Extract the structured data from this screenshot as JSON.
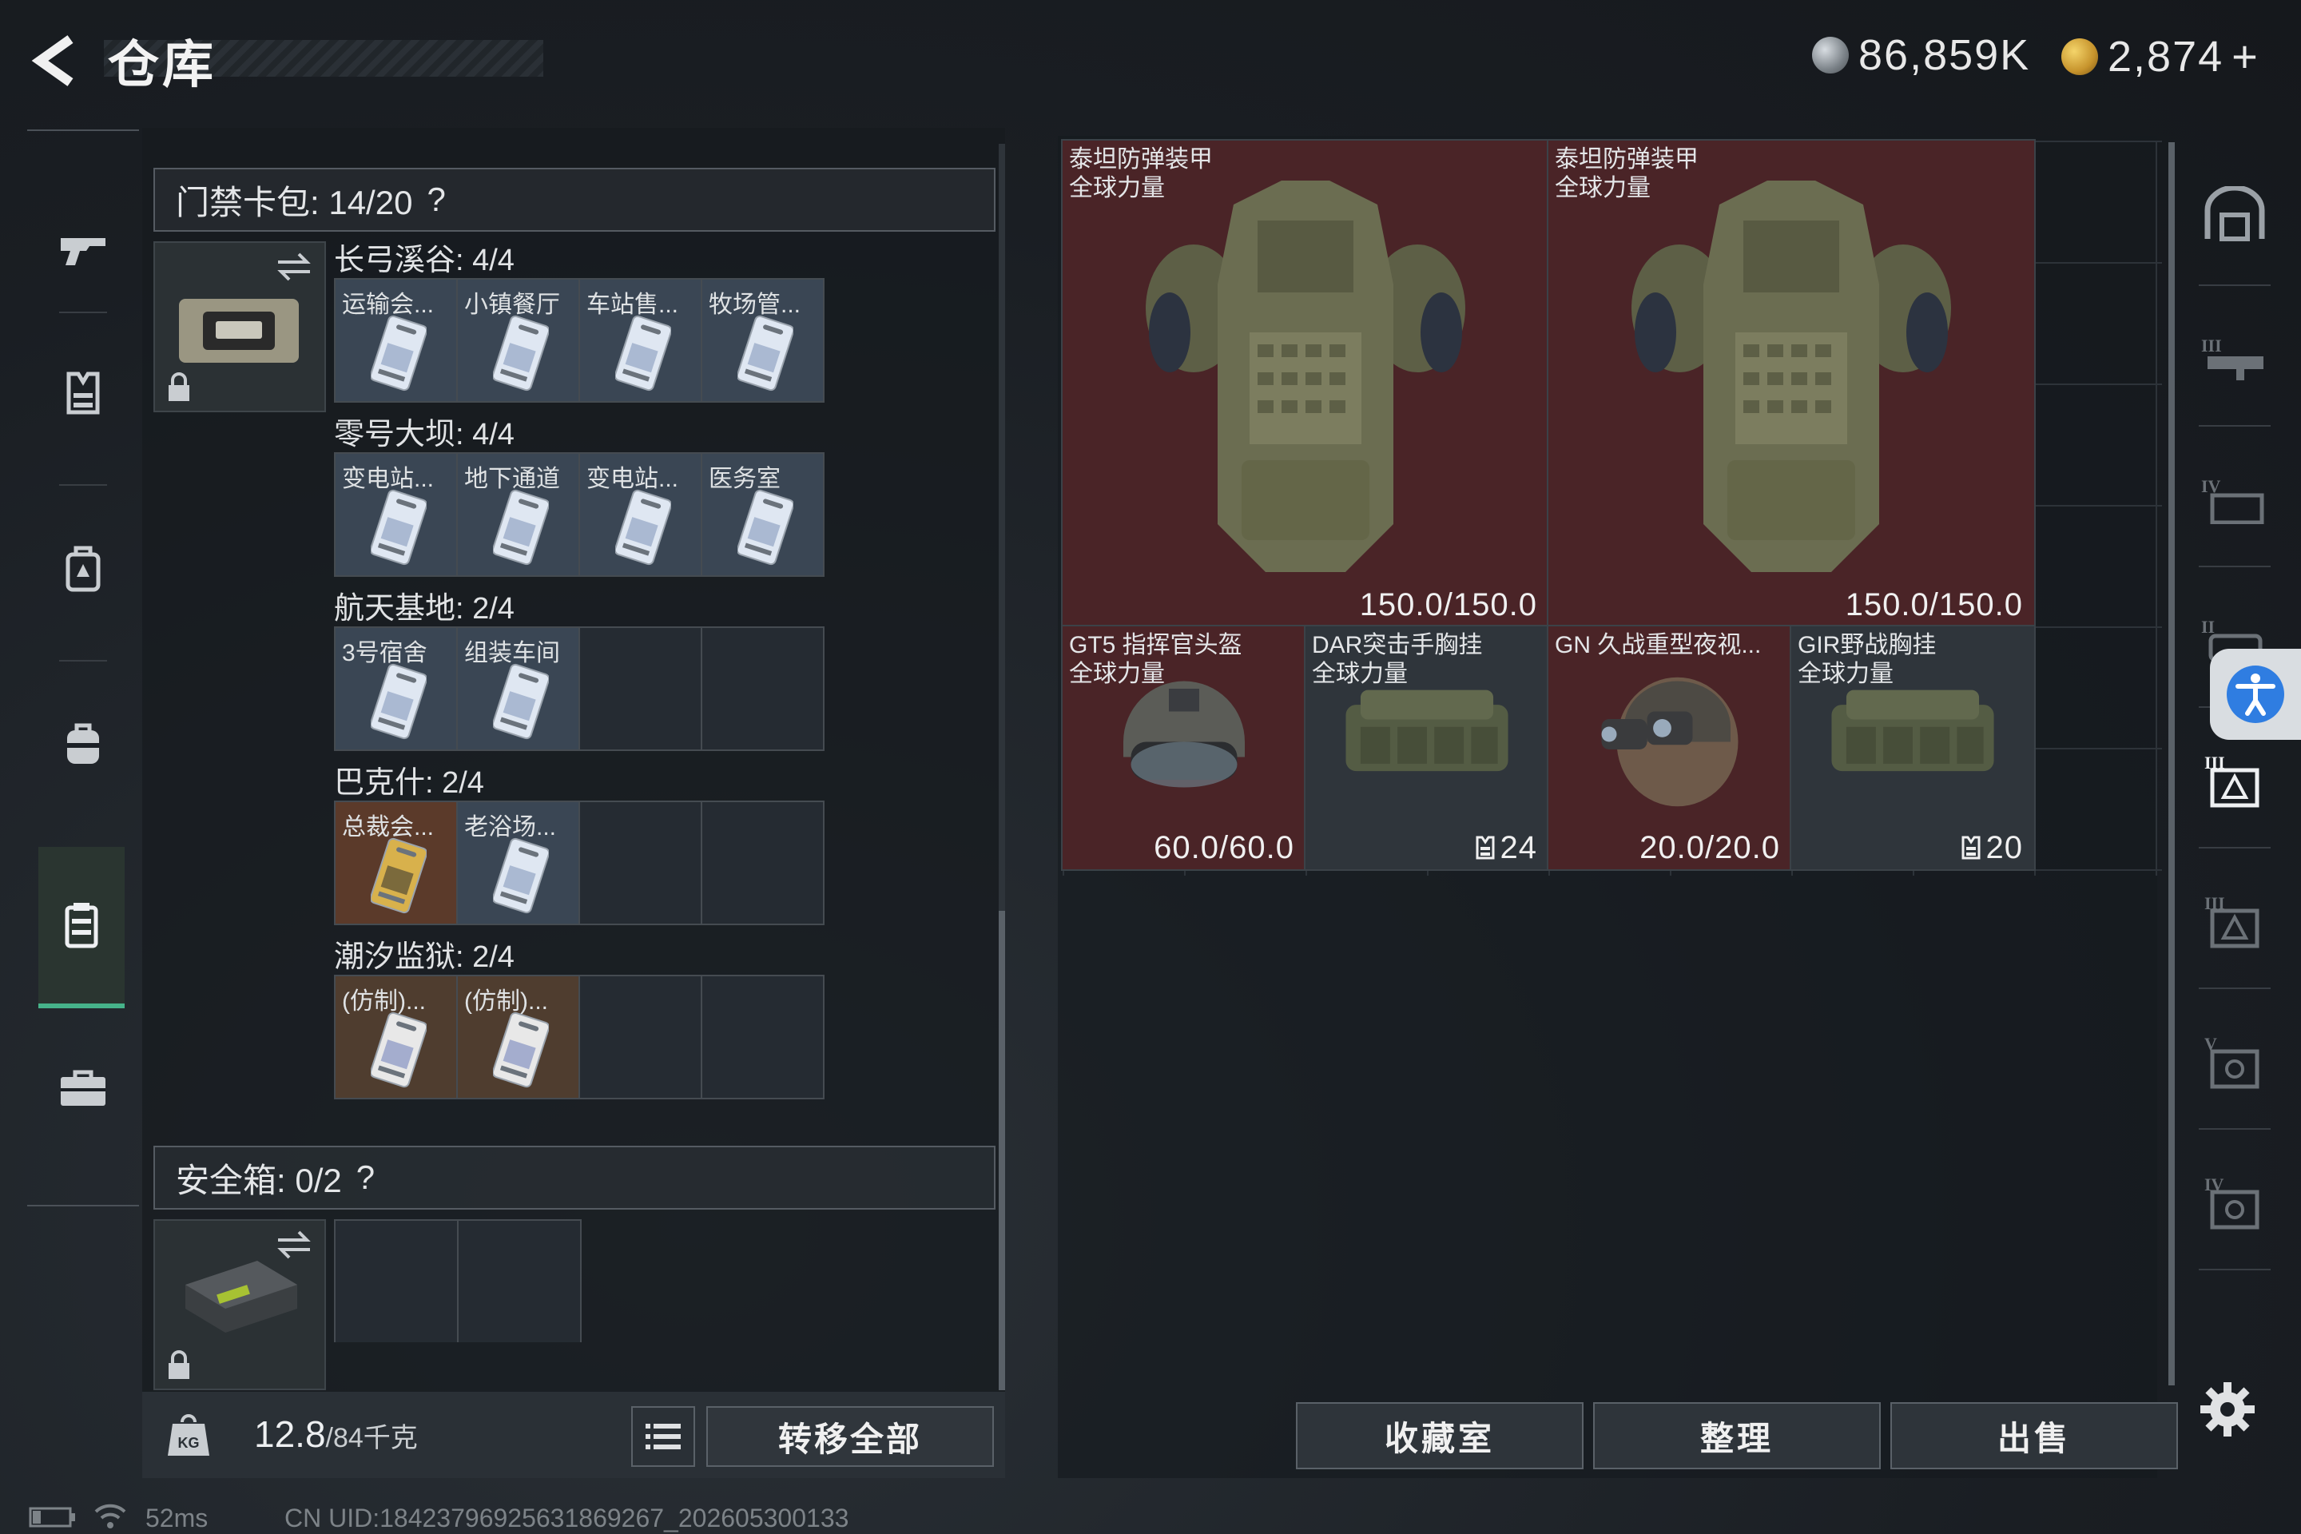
{
  "header": {
    "title": "仓库",
    "currency_silver": "86,859K",
    "currency_gold": "2,874",
    "plus_label": "+"
  },
  "card_pack": {
    "header": "门禁卡包: 14/20",
    "help": "?",
    "areas": [
      {
        "label": "长弓溪谷: 4/4",
        "slots": [
          {
            "name": "运输会...",
            "style": "blue"
          },
          {
            "name": "小镇餐厅",
            "style": "blue"
          },
          {
            "name": "车站售...",
            "style": "blue"
          },
          {
            "name": "牧场管...",
            "style": "blue"
          }
        ]
      },
      {
        "label": "零号大坝: 4/4",
        "slots": [
          {
            "name": "变电站...",
            "style": "blue"
          },
          {
            "name": "地下通道",
            "style": "blue"
          },
          {
            "name": "变电站...",
            "style": "blue"
          },
          {
            "name": "医务室",
            "style": "blue"
          }
        ]
      },
      {
        "label": "航天基地: 2/4",
        "slots": [
          {
            "name": "3号宿舍",
            "style": "blue"
          },
          {
            "name": "组装车间",
            "style": "blue"
          },
          {
            "name": "",
            "style": "empty"
          },
          {
            "name": "",
            "style": "empty"
          }
        ]
      },
      {
        "label": "巴克什: 2/4",
        "slots": [
          {
            "name": "总裁会...",
            "style": "gold"
          },
          {
            "name": "老浴场...",
            "style": "blue"
          },
          {
            "name": "",
            "style": "empty"
          },
          {
            "name": "",
            "style": "empty"
          }
        ]
      },
      {
        "label": "潮汐监狱: 2/4",
        "slots": [
          {
            "name": "(仿制)...",
            "style": "bronze"
          },
          {
            "name": "(仿制)...",
            "style": "bronze"
          },
          {
            "name": "",
            "style": "empty"
          },
          {
            "name": "",
            "style": "empty"
          }
        ]
      }
    ]
  },
  "safe_box": {
    "header": "安全箱: 0/2",
    "help": "?"
  },
  "footer_left": {
    "kg_label": "KG",
    "weight_current": "12.8",
    "weight_max": "/84千克",
    "transfer_all": "转移全部"
  },
  "stash_items": [
    {
      "name": "泰坦防弹装甲",
      "sub": "全球力量",
      "value": "150.0/150.0",
      "kind": "armor"
    },
    {
      "name": "泰坦防弹装甲",
      "sub": "全球力量",
      "value": "150.0/150.0",
      "kind": "armor"
    },
    {
      "name": "GT5 指挥官头盔",
      "sub": "全球力量",
      "value": "60.0/60.0",
      "kind": "helmet"
    },
    {
      "name": "DAR突击手胸挂",
      "sub": "全球力量",
      "value": "24",
      "kind": "rig"
    },
    {
      "name": "GN 久战重型夜视...",
      "sub": "",
      "value": "20.0/20.0",
      "kind": "nvg"
    },
    {
      "name": "GIR野战胸挂",
      "sub": "全球力量",
      "value": "20",
      "kind": "rig"
    }
  ],
  "bottom_buttons": {
    "collection": "收藏室",
    "sort": "整理",
    "sell": "出售"
  },
  "status_bar": {
    "ping": "52ms",
    "uid": "CN UID:18423796925631869267_202605300133"
  },
  "colors": {
    "accent_green": "#46b38a",
    "armor_bg": "#4a2427",
    "card_blue": "#3a4654",
    "access_blue": "#2f7de1"
  }
}
